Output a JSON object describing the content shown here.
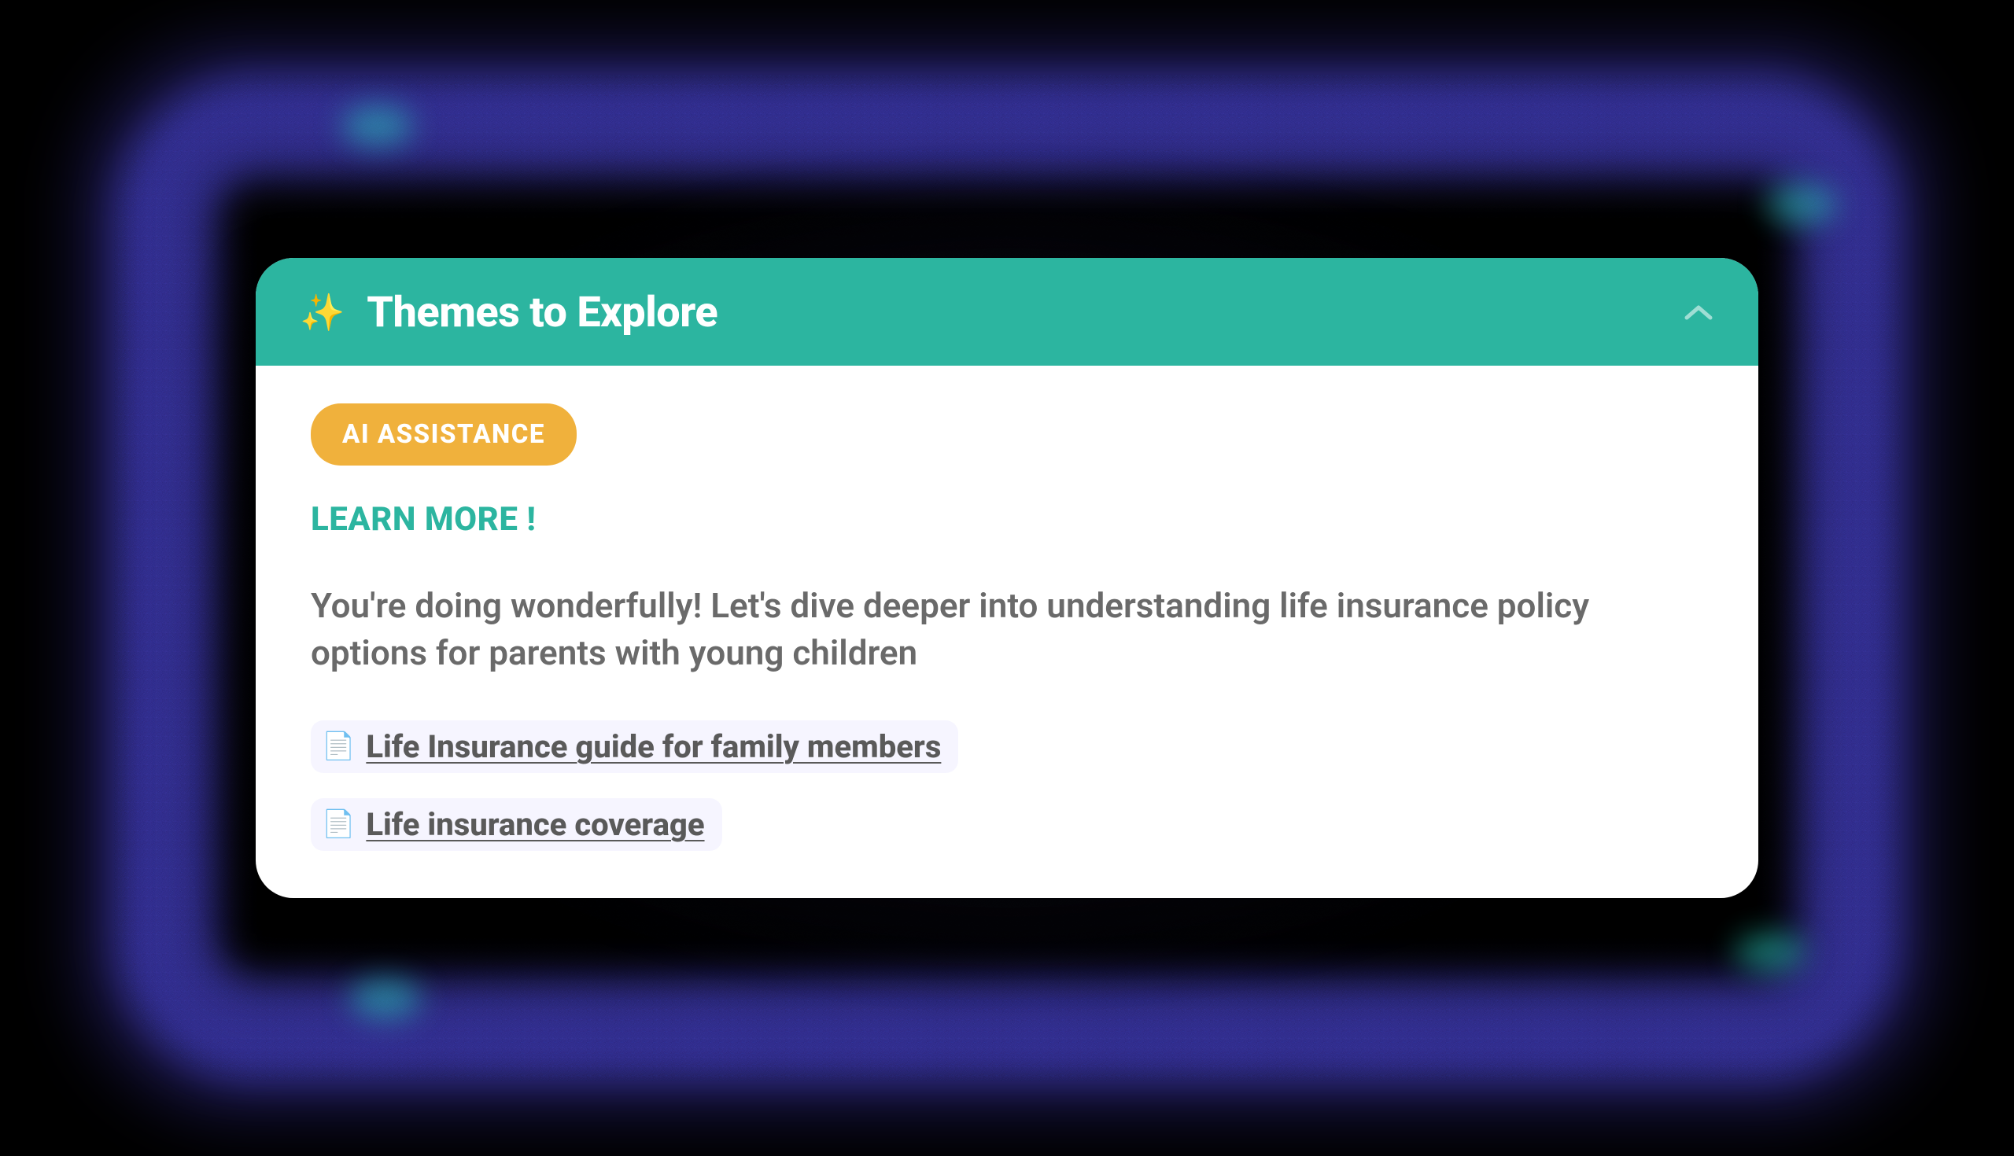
{
  "card": {
    "header": {
      "title": "Themes to Explore",
      "sparkle_emoji": "✨"
    },
    "badge": "AI ASSISTANCE",
    "learn_more": "LEARN MORE !",
    "description": "You're doing wonderfully! Let's dive deeper into understanding life insurance policy options for parents with young children",
    "links": [
      {
        "label": "Life Insurance guide for family members"
      },
      {
        "label": "Life insurance coverage"
      }
    ]
  },
  "colors": {
    "header_bg": "#2cb5a0",
    "badge_bg": "#f0b13c",
    "glow": "#5f55fa"
  }
}
